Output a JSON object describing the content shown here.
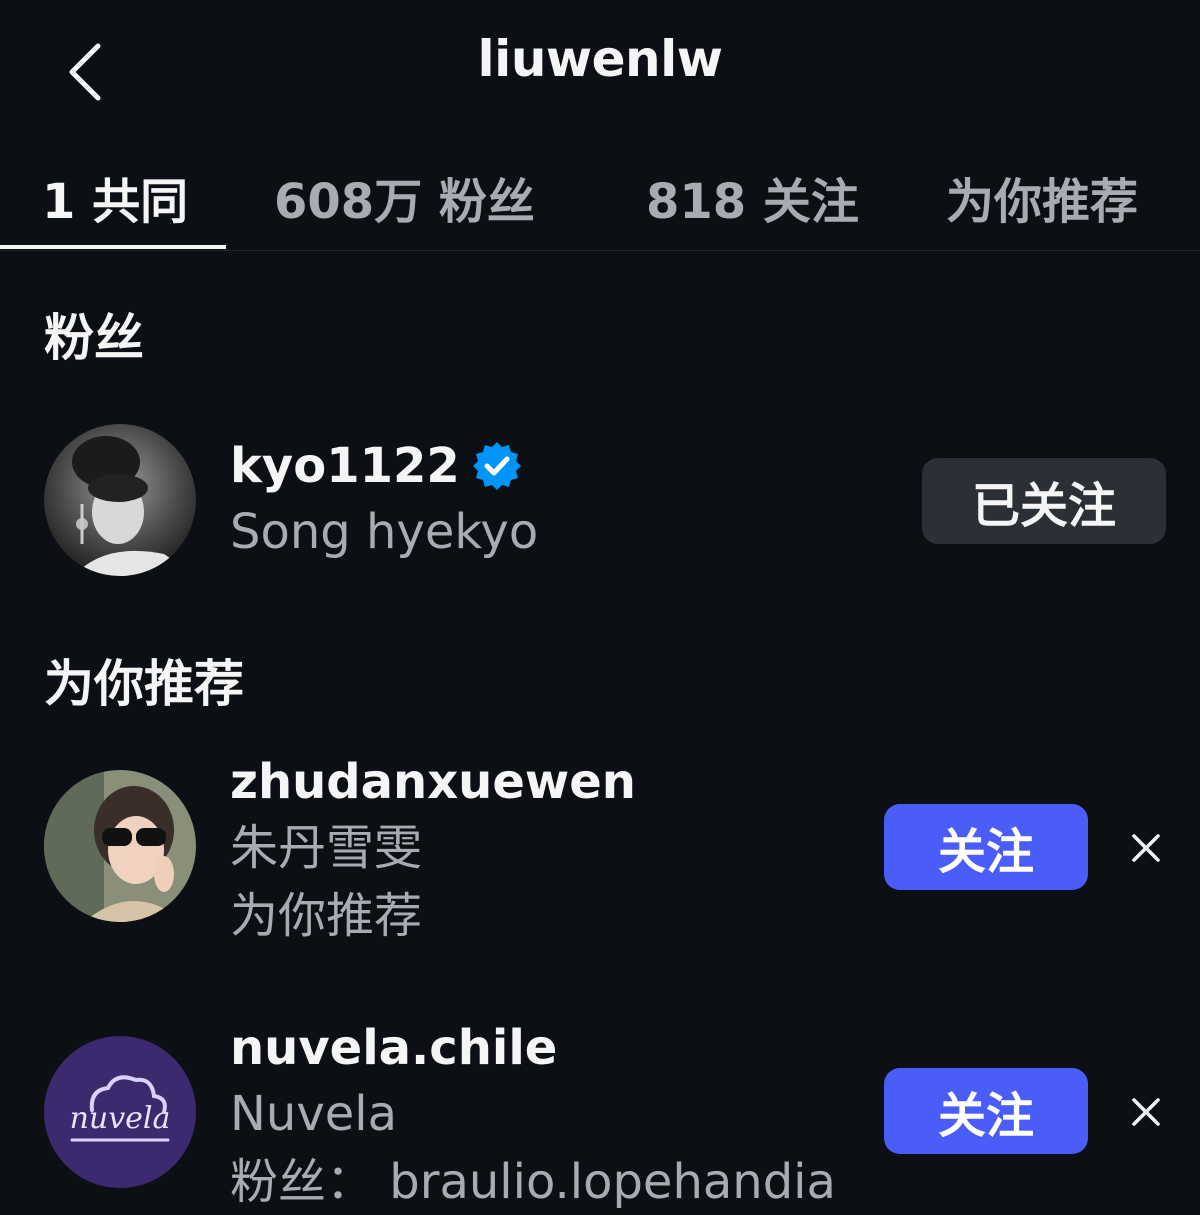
{
  "header": {
    "title": "liuwenlw"
  },
  "tabs": [
    {
      "label": "1 共同",
      "active": true
    },
    {
      "label": "608万 粉丝",
      "active": false
    },
    {
      "label": "818 关注",
      "active": false
    },
    {
      "label": "为你推荐",
      "active": false
    }
  ],
  "sections": {
    "followers_heading": "粉丝",
    "suggested_heading": "为你推荐"
  },
  "followers": [
    {
      "username": "kyo1122",
      "verified": true,
      "full_name": "Song hyekyo",
      "button_label": "已关注"
    }
  ],
  "suggested": [
    {
      "username": "zhudanxuewen",
      "full_name": "朱丹雪雯",
      "context": "为你推荐",
      "button_label": "关注"
    },
    {
      "username": "nuvela.chile",
      "full_name": "Nuvela",
      "context": "粉丝： braulio.lopehandia",
      "button_label": "关注",
      "logo_text": "nuvela"
    }
  ],
  "colors": {
    "background": "#0c1014",
    "primary_text": "#f5f5f5",
    "secondary_text": "#a8acb2",
    "follow_button": "#4a5df9",
    "following_button": "#2b3036",
    "verified_badge": "#0095f6",
    "nuvela_avatar": "#3b2a6e"
  }
}
